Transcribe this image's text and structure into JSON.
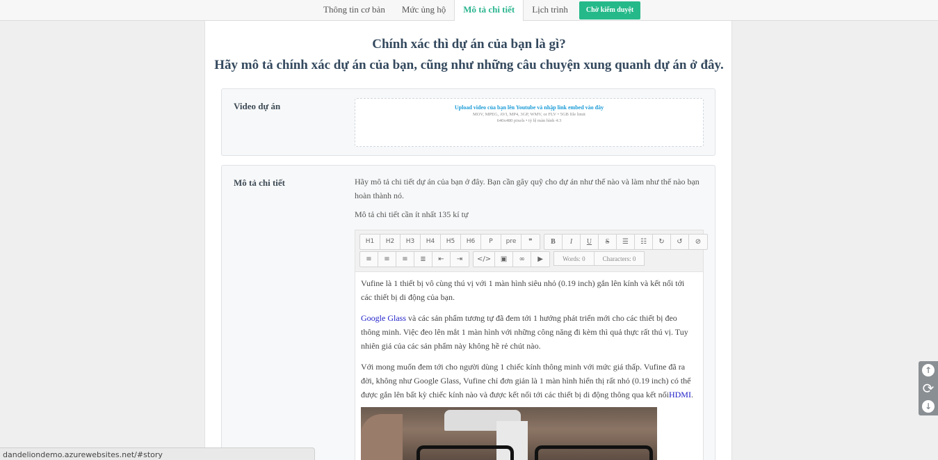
{
  "tabs": [
    {
      "label": "Thông tin cơ bản"
    },
    {
      "label": "Mức ủng hộ"
    },
    {
      "label": "Mô tả chi tiết"
    },
    {
      "label": "Lịch trình"
    }
  ],
  "submit_label": "Chờ kiểm duyệt",
  "heading": {
    "line1": "Chính xác thì dự án của bạn là gì?",
    "line2": "Hãy mô tả chính xác dự án của bạn, cũng như những câu chuyện xung quanh dự án ở đây."
  },
  "video": {
    "label": "Video dự án",
    "upload_title": "Upload video của bạn lên Youtube và nhập link embed vào đây",
    "upload_formats": "MOV, MPEG, AVI, MP4, 3GP, WMV, or FLV • 5GB file limit",
    "upload_size": "640x480 pixels • tỷ lệ màn hình 4:3"
  },
  "description": {
    "label": "Mô tả chi tiết",
    "help": "Hãy mô tả chi tiết dự án của bạn ở đây. Bạn cần gây quỹ cho dự án như thế nào và làm như thế nào bạn hoàn thành nó.",
    "min_chars": "Mô tả chi tiết cần ít nhất 135 kí tự"
  },
  "toolbar": {
    "row1": [
      "H1",
      "H2",
      "H3",
      "H4",
      "H5",
      "H6",
      "P",
      "pre",
      "❞"
    ],
    "format": [
      "B",
      "I",
      "U",
      "S"
    ],
    "words": "Words: 0",
    "characters": "Characters: 0"
  },
  "content": {
    "p1": "Vufine là 1 thiết bị vô cùng thú vị với 1 màn hình siêu nhỏ (0.19 inch) gắn lên kính và kết nối tới các thiết bị di động của bạn.",
    "p2_link": "Google Glass",
    "p2_rest": " và các sản phẩm tương tự đã đem tới 1 hướng phát triển mới cho các thiết bị đeo thông minh. Việc đeo lên mắt 1 màn hình với những công năng đi kèm thì quả thực rất thú vị. Tuy nhiên giá của các sản phẩm này không hề rẻ chút nào.",
    "p3_text": "Với mong muốn đem tới cho người dùng 1 chiếc kính thông minh với mức giá thấp. Vufine đã ra đời, không như Google Glass, Vufine chỉ đơn giản là 1 màn hình hiển thị rất nhỏ (0.19 inch) có thể được gắn lên bất kỳ chiếc kính nào và được kết nối tới các thiết bị di động thông qua kết nối",
    "p3_link": "HDMI",
    "p3_end": "."
  },
  "statusbar": "dandeliondemo.azurewebsites.net/#story",
  "colors": {
    "accent": "#25b989",
    "link": "#1c1cc9",
    "heading": "#34495e"
  }
}
